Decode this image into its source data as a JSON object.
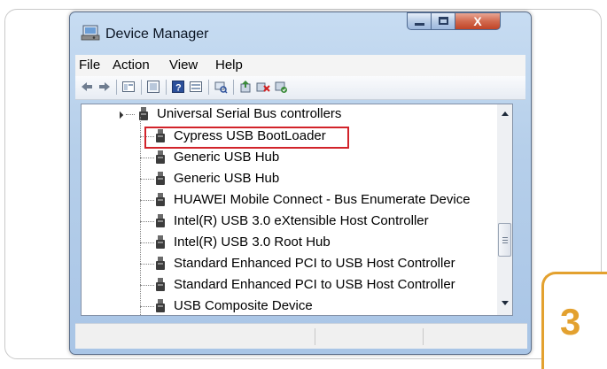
{
  "window": {
    "title": "Device Manager",
    "buttons": {
      "minimize": "",
      "maximize": "",
      "close": "X"
    }
  },
  "menubar": {
    "items": [
      "File",
      "Action",
      "View",
      "Help"
    ]
  },
  "toolbar": {
    "icons": [
      "back-icon",
      "forward-icon",
      "properties-view-icon",
      "show-hide-console-icon",
      "help-icon",
      "details-pane-icon",
      "scan-hardware-icon",
      "update-driver-icon",
      "uninstall-icon",
      "enable-device-icon"
    ]
  },
  "tree": {
    "category": "Universal Serial Bus controllers",
    "devices": [
      "Cypress USB BootLoader",
      "Generic USB Hub",
      "Generic USB Hub",
      "HUAWEI Mobile Connect - Bus Enumerate Device",
      "Intel(R) USB 3.0 eXtensible Host Controller",
      "Intel(R) USB 3.0 Root Hub",
      "Standard Enhanced PCI to USB Host Controller",
      "Standard Enhanced PCI to USB Host Controller",
      "USB Composite Device"
    ],
    "highlighted_device": "Cypress USB BootLoader"
  },
  "step": {
    "number": "3"
  },
  "colors": {
    "highlight_border": "#d2232a",
    "step_accent": "#e3a12f",
    "close_button": "#c04427"
  }
}
